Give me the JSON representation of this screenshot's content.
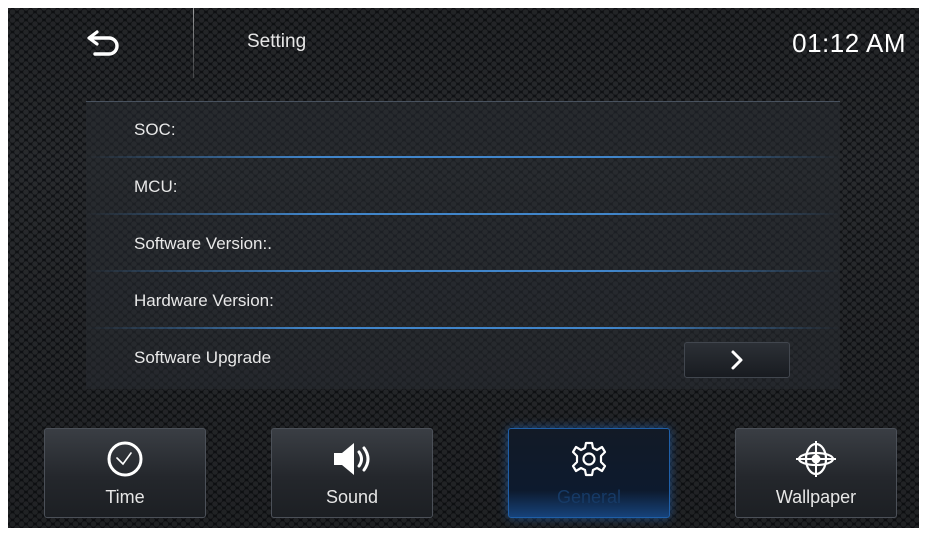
{
  "header": {
    "title": "Setting",
    "clock": "01:12 AM",
    "back_icon": "back-arrow-icon"
  },
  "info_rows": [
    {
      "label": "SOC:"
    },
    {
      "label": "MCU:"
    },
    {
      "label": "Software Version:."
    },
    {
      "label": "Hardware Version:"
    },
    {
      "label": "Software Upgrade",
      "action_icon": "chevron-right-icon"
    }
  ],
  "tabs": [
    {
      "label": "Time",
      "icon": "clock-icon",
      "active": false
    },
    {
      "label": "Sound",
      "icon": "speaker-icon",
      "active": false
    },
    {
      "label": "General",
      "icon": "gear-icon",
      "active": true
    },
    {
      "label": "Wallpaper",
      "icon": "wallpaper-icon",
      "active": false
    }
  ],
  "colors": {
    "background": "#101215",
    "accent_blue": "#1f5fa8",
    "text": "#e6e6e6"
  }
}
